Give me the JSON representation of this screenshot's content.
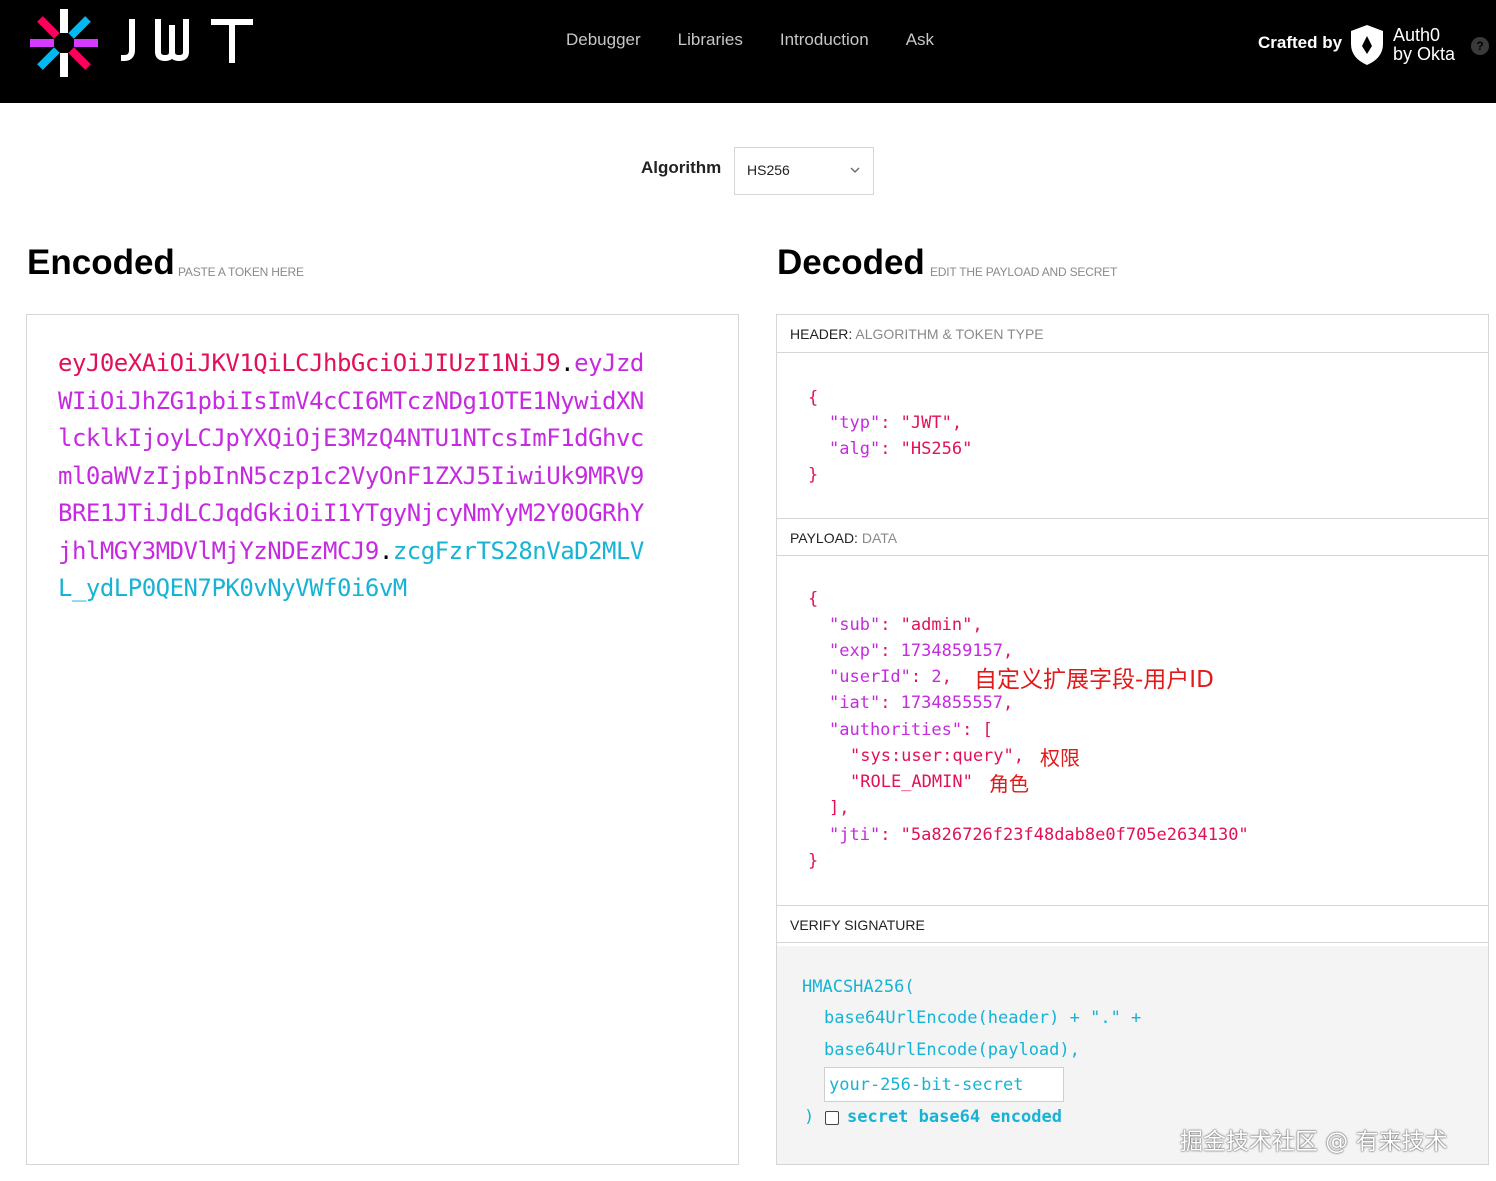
{
  "nav": {
    "items": [
      "Debugger",
      "Libraries",
      "Introduction",
      "Ask"
    ],
    "crafted_by": "Crafted by",
    "brand_line1": "Auth0",
    "brand_line2": "by Okta",
    "help": "?"
  },
  "algorithm": {
    "label": "Algorithm",
    "value": "HS256"
  },
  "encoded": {
    "title": "Encoded",
    "subtitle": "PASTE A TOKEN HERE",
    "token_header": "eyJ0eXAiOiJKV1QiLCJhbGciOiJIUzI1NiJ9",
    "token_payload": "eyJzdWIiOiJhZG1pbiIsImV4cCI6MTczNDg1OTE1NywidXNlcklkIjoyLCJpYXQiOjE3MzQ4NTU1NTcsImF1dGhvcml0aWVzIjpbInN5czp1c2VyOnF1ZXJ5IiwiUk9MRV9BRE1JTiJdLCJqdGkiOiI1YTgyNjcyNmYyM2Y0OGRhYjhlMGY3MDVlMjYzNDEzMCJ9",
    "token_signature": "zcgFzrTS28nVaD2MLVL_ydLP0QEN7PK0vNyVWf0i6vM",
    "dot": "."
  },
  "decoded": {
    "title": "Decoded",
    "subtitle": "EDIT THE PAYLOAD AND SECRET",
    "header_label": "HEADER:",
    "header_desc": "ALGORITHM & TOKEN TYPE",
    "payload_label": "PAYLOAD:",
    "payload_desc": "DATA",
    "verify_label": "VERIFY SIGNATURE",
    "header_json": {
      "open": "{",
      "typ_key": "\"typ\"",
      "typ_val": "\"JWT\"",
      "alg_key": "\"alg\"",
      "alg_val": "\"HS256\"",
      "close": "}"
    },
    "payload_json": {
      "open": "{",
      "sub_key": "\"sub\"",
      "sub_val": "\"admin\"",
      "exp_key": "\"exp\"",
      "exp_val": "1734859157",
      "userId_key": "\"userId\"",
      "userId_val": "2",
      "iat_key": "\"iat\"",
      "iat_val": "1734855557",
      "authorities_key": "\"authorities\"",
      "auth_0": "\"sys:user:query\"",
      "auth_1": "\"ROLE_ADMIN\"",
      "arr_close": "],",
      "jti_key": "\"jti\"",
      "jti_val": "\"5a826726f23f48dab8e0f705e2634130\"",
      "close": "}"
    },
    "annotations": {
      "userId": "自定义扩展字段-用户ID",
      "authority": "权限",
      "role": "角色"
    },
    "verify": {
      "fn": "HMACSHA256(",
      "line1": "base64UrlEncode(header) + \".\" +",
      "line2": "base64UrlEncode(payload),",
      "secret_placeholder": "your-256-bit-secret",
      "close": ")",
      "checkbox_label": "secret base64 encoded"
    }
  },
  "watermark": "掘金技术社区 @ 有来技术",
  "colors": {
    "header": "#e2105a",
    "payload": "#c52ae0",
    "signature": "#17b3d6",
    "annotation": "#e0191b"
  }
}
